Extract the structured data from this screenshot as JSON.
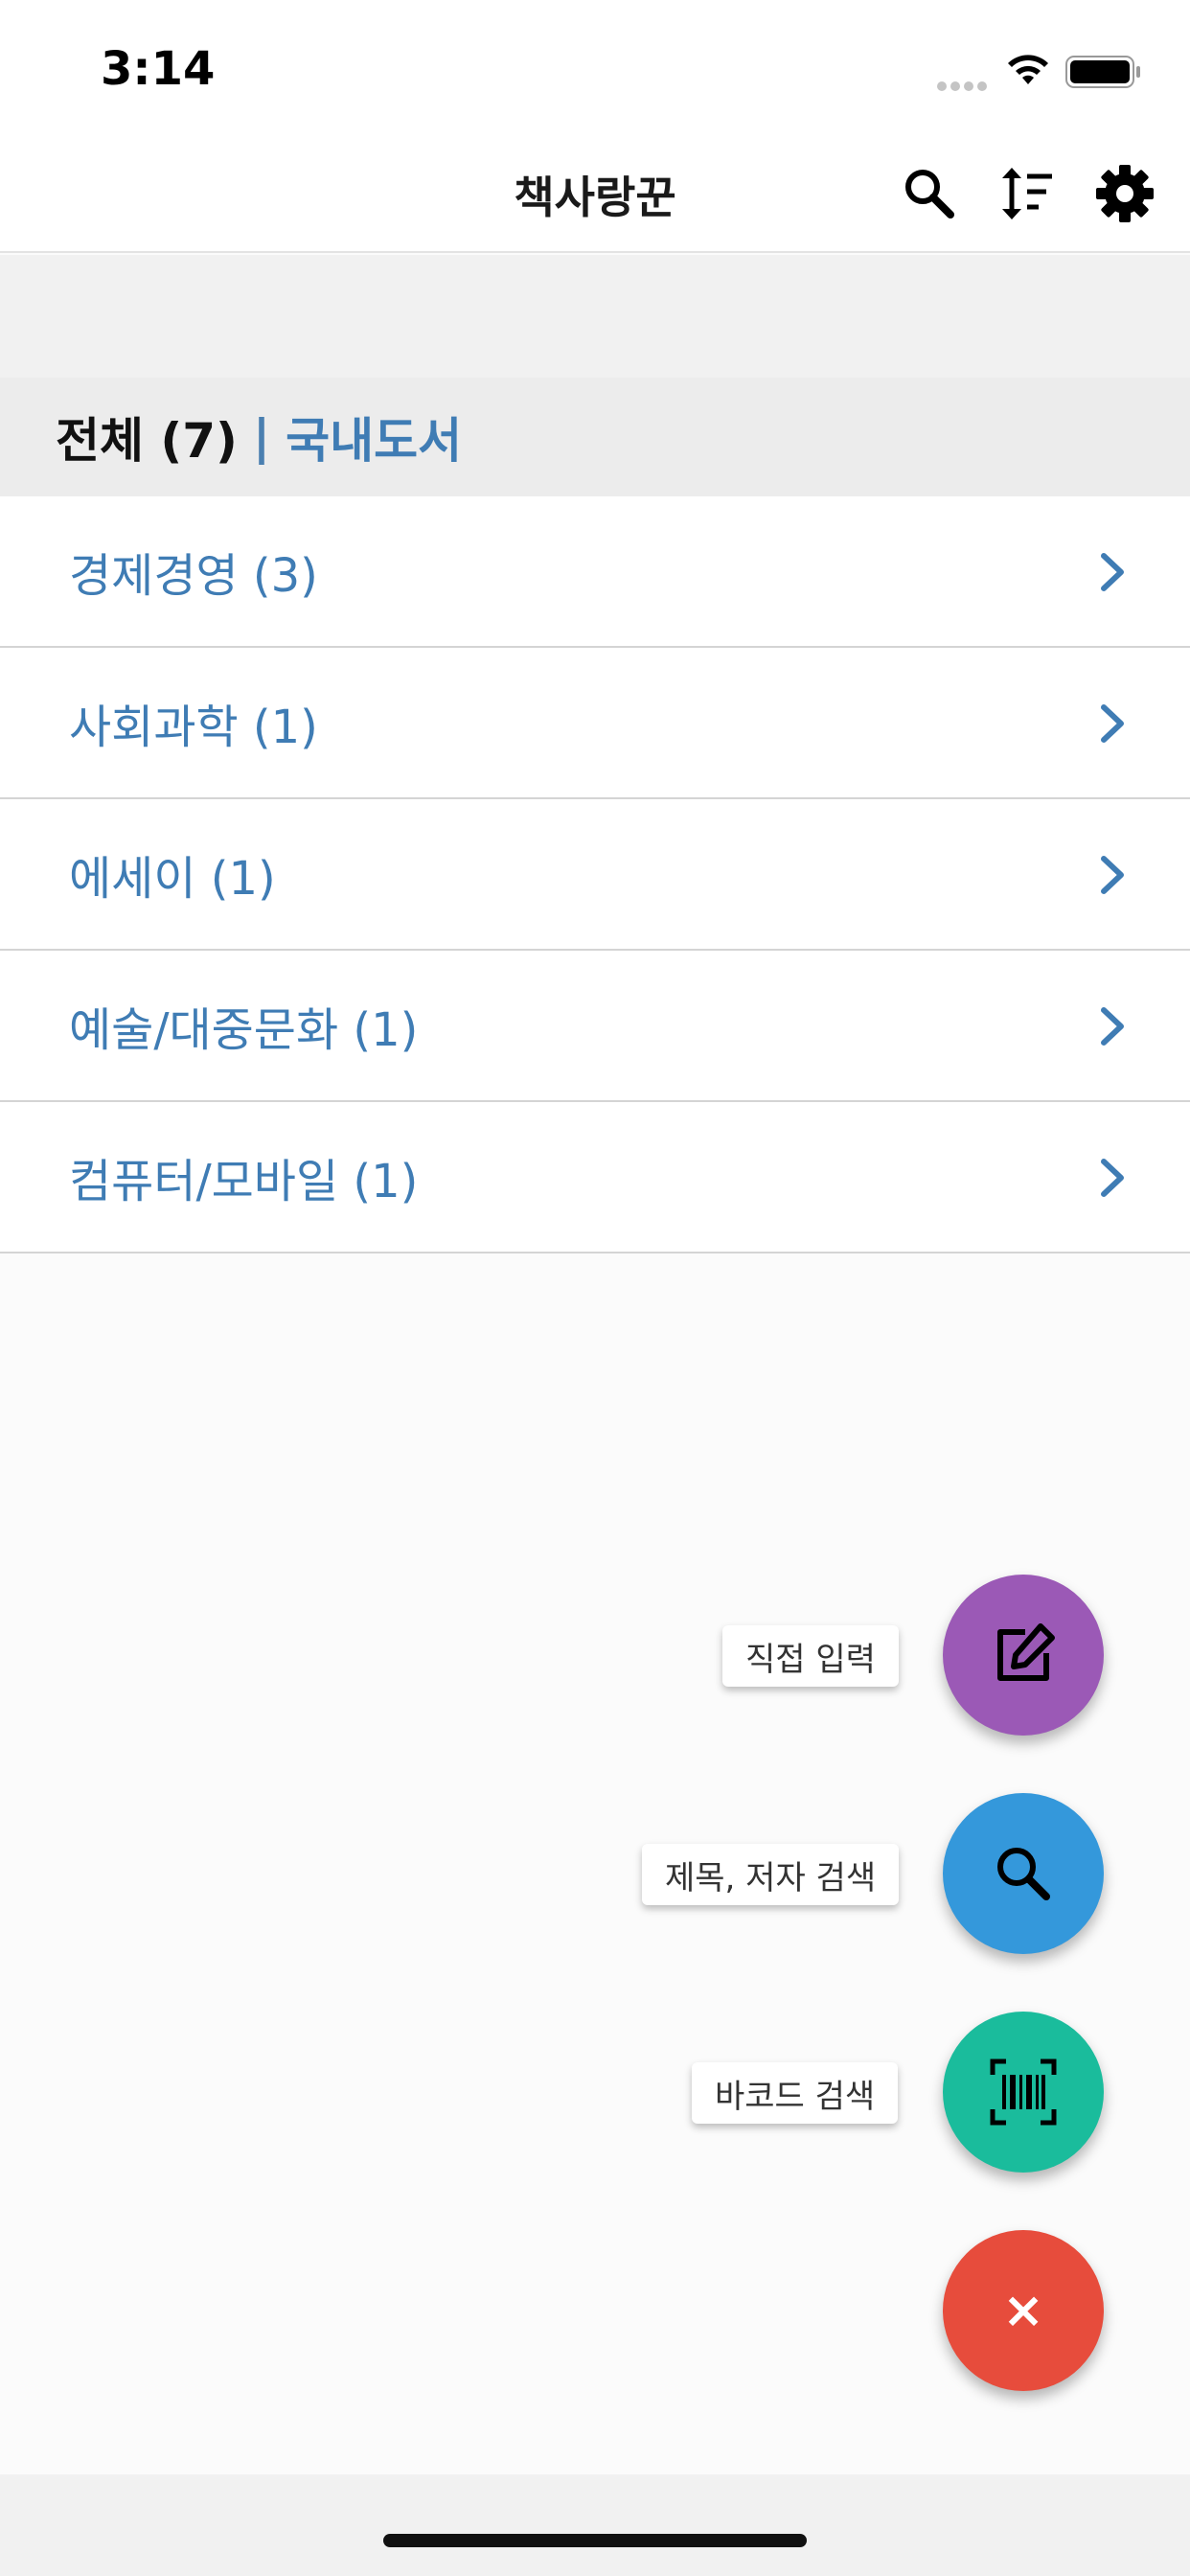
{
  "status_bar": {
    "time": "3:14"
  },
  "nav": {
    "title": "책사랑꾼",
    "search_icon": "search-icon",
    "sort_icon": "sort-icon",
    "settings_icon": "gear-icon"
  },
  "section": {
    "total_label": "전체 (7)",
    "separator": "|",
    "tab_label": "국내도서"
  },
  "categories": [
    {
      "label": "경제경영 (3)"
    },
    {
      "label": "사회과학 (1)"
    },
    {
      "label": "에세이 (1)"
    },
    {
      "label": "예술/대중문화 (1)"
    },
    {
      "label": "컴퓨터/모바일 (1)"
    }
  ],
  "fab_menu": {
    "manual_entry_label": "직접 입력",
    "title_author_search_label": "제목, 저자 검색",
    "barcode_search_label": "바코드 검색",
    "close_symbol": "×"
  },
  "colors": {
    "accent_blue": "#3f7cb4",
    "fab_purple": "#9b59b6",
    "fab_blue": "#3498db",
    "fab_green": "#1abc9c",
    "fab_red": "#e74c3c"
  }
}
